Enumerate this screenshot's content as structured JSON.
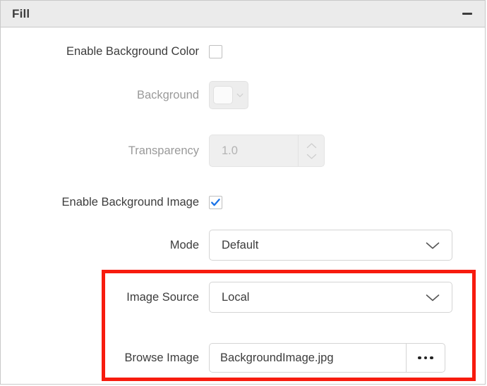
{
  "panel": {
    "title": "Fill",
    "collapse_icon": "minus-icon",
    "collapse_tooltip": "Collapse"
  },
  "rows": {
    "enable_background_color": {
      "label": "Enable Background Color",
      "checked": false,
      "checkbox_icon": "checkbox-unchecked-icon"
    },
    "background": {
      "label": "Background",
      "disabled": true,
      "swatch_color": "#fbfbfb",
      "chevron_icon": "chevron-down-icon"
    },
    "transparency": {
      "label": "Transparency",
      "value": "1.0",
      "disabled": true,
      "up_icon": "chevron-up-icon",
      "down_icon": "chevron-down-icon"
    },
    "enable_background_image": {
      "label": "Enable Background Image",
      "checked": true,
      "checkbox_icon": "checkbox-checked-icon",
      "check_color": "#1a73e8"
    },
    "mode": {
      "label": "Mode",
      "value": "Default",
      "chevron_icon": "chevron-down-icon"
    },
    "image_source": {
      "label": "Image Source",
      "value": "Local",
      "chevron_icon": "chevron-down-icon"
    },
    "browse_image": {
      "label": "Browse Image",
      "value": "BackgroundImage.jpg",
      "button_icon": "ellipsis-icon"
    }
  },
  "annotation": {
    "highlight_color": "#f71b0e"
  }
}
